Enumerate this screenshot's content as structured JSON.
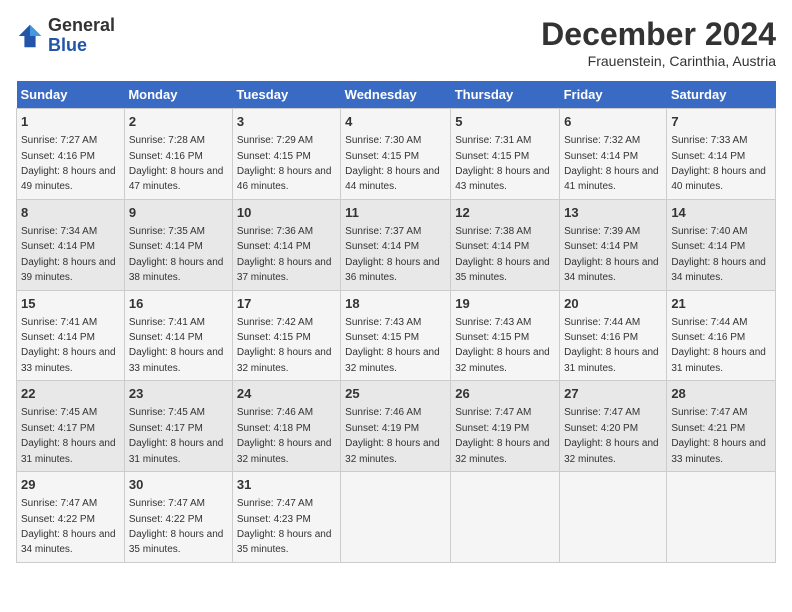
{
  "logo": {
    "general": "General",
    "blue": "Blue"
  },
  "header": {
    "month": "December 2024",
    "location": "Frauenstein, Carinthia, Austria"
  },
  "weekdays": [
    "Sunday",
    "Monday",
    "Tuesday",
    "Wednesday",
    "Thursday",
    "Friday",
    "Saturday"
  ],
  "weeks": [
    [
      {
        "day": "1",
        "sunrise": "Sunrise: 7:27 AM",
        "sunset": "Sunset: 4:16 PM",
        "daylight": "Daylight: 8 hours and 49 minutes."
      },
      {
        "day": "2",
        "sunrise": "Sunrise: 7:28 AM",
        "sunset": "Sunset: 4:16 PM",
        "daylight": "Daylight: 8 hours and 47 minutes."
      },
      {
        "day": "3",
        "sunrise": "Sunrise: 7:29 AM",
        "sunset": "Sunset: 4:15 PM",
        "daylight": "Daylight: 8 hours and 46 minutes."
      },
      {
        "day": "4",
        "sunrise": "Sunrise: 7:30 AM",
        "sunset": "Sunset: 4:15 PM",
        "daylight": "Daylight: 8 hours and 44 minutes."
      },
      {
        "day": "5",
        "sunrise": "Sunrise: 7:31 AM",
        "sunset": "Sunset: 4:15 PM",
        "daylight": "Daylight: 8 hours and 43 minutes."
      },
      {
        "day": "6",
        "sunrise": "Sunrise: 7:32 AM",
        "sunset": "Sunset: 4:14 PM",
        "daylight": "Daylight: 8 hours and 41 minutes."
      },
      {
        "day": "7",
        "sunrise": "Sunrise: 7:33 AM",
        "sunset": "Sunset: 4:14 PM",
        "daylight": "Daylight: 8 hours and 40 minutes."
      }
    ],
    [
      {
        "day": "8",
        "sunrise": "Sunrise: 7:34 AM",
        "sunset": "Sunset: 4:14 PM",
        "daylight": "Daylight: 8 hours and 39 minutes."
      },
      {
        "day": "9",
        "sunrise": "Sunrise: 7:35 AM",
        "sunset": "Sunset: 4:14 PM",
        "daylight": "Daylight: 8 hours and 38 minutes."
      },
      {
        "day": "10",
        "sunrise": "Sunrise: 7:36 AM",
        "sunset": "Sunset: 4:14 PM",
        "daylight": "Daylight: 8 hours and 37 minutes."
      },
      {
        "day": "11",
        "sunrise": "Sunrise: 7:37 AM",
        "sunset": "Sunset: 4:14 PM",
        "daylight": "Daylight: 8 hours and 36 minutes."
      },
      {
        "day": "12",
        "sunrise": "Sunrise: 7:38 AM",
        "sunset": "Sunset: 4:14 PM",
        "daylight": "Daylight: 8 hours and 35 minutes."
      },
      {
        "day": "13",
        "sunrise": "Sunrise: 7:39 AM",
        "sunset": "Sunset: 4:14 PM",
        "daylight": "Daylight: 8 hours and 34 minutes."
      },
      {
        "day": "14",
        "sunrise": "Sunrise: 7:40 AM",
        "sunset": "Sunset: 4:14 PM",
        "daylight": "Daylight: 8 hours and 34 minutes."
      }
    ],
    [
      {
        "day": "15",
        "sunrise": "Sunrise: 7:41 AM",
        "sunset": "Sunset: 4:14 PM",
        "daylight": "Daylight: 8 hours and 33 minutes."
      },
      {
        "day": "16",
        "sunrise": "Sunrise: 7:41 AM",
        "sunset": "Sunset: 4:14 PM",
        "daylight": "Daylight: 8 hours and 33 minutes."
      },
      {
        "day": "17",
        "sunrise": "Sunrise: 7:42 AM",
        "sunset": "Sunset: 4:15 PM",
        "daylight": "Daylight: 8 hours and 32 minutes."
      },
      {
        "day": "18",
        "sunrise": "Sunrise: 7:43 AM",
        "sunset": "Sunset: 4:15 PM",
        "daylight": "Daylight: 8 hours and 32 minutes."
      },
      {
        "day": "19",
        "sunrise": "Sunrise: 7:43 AM",
        "sunset": "Sunset: 4:15 PM",
        "daylight": "Daylight: 8 hours and 32 minutes."
      },
      {
        "day": "20",
        "sunrise": "Sunrise: 7:44 AM",
        "sunset": "Sunset: 4:16 PM",
        "daylight": "Daylight: 8 hours and 31 minutes."
      },
      {
        "day": "21",
        "sunrise": "Sunrise: 7:44 AM",
        "sunset": "Sunset: 4:16 PM",
        "daylight": "Daylight: 8 hours and 31 minutes."
      }
    ],
    [
      {
        "day": "22",
        "sunrise": "Sunrise: 7:45 AM",
        "sunset": "Sunset: 4:17 PM",
        "daylight": "Daylight: 8 hours and 31 minutes."
      },
      {
        "day": "23",
        "sunrise": "Sunrise: 7:45 AM",
        "sunset": "Sunset: 4:17 PM",
        "daylight": "Daylight: 8 hours and 31 minutes."
      },
      {
        "day": "24",
        "sunrise": "Sunrise: 7:46 AM",
        "sunset": "Sunset: 4:18 PM",
        "daylight": "Daylight: 8 hours and 32 minutes."
      },
      {
        "day": "25",
        "sunrise": "Sunrise: 7:46 AM",
        "sunset": "Sunset: 4:19 PM",
        "daylight": "Daylight: 8 hours and 32 minutes."
      },
      {
        "day": "26",
        "sunrise": "Sunrise: 7:47 AM",
        "sunset": "Sunset: 4:19 PM",
        "daylight": "Daylight: 8 hours and 32 minutes."
      },
      {
        "day": "27",
        "sunrise": "Sunrise: 7:47 AM",
        "sunset": "Sunset: 4:20 PM",
        "daylight": "Daylight: 8 hours and 32 minutes."
      },
      {
        "day": "28",
        "sunrise": "Sunrise: 7:47 AM",
        "sunset": "Sunset: 4:21 PM",
        "daylight": "Daylight: 8 hours and 33 minutes."
      }
    ],
    [
      {
        "day": "29",
        "sunrise": "Sunrise: 7:47 AM",
        "sunset": "Sunset: 4:22 PM",
        "daylight": "Daylight: 8 hours and 34 minutes."
      },
      {
        "day": "30",
        "sunrise": "Sunrise: 7:47 AM",
        "sunset": "Sunset: 4:22 PM",
        "daylight": "Daylight: 8 hours and 35 minutes."
      },
      {
        "day": "31",
        "sunrise": "Sunrise: 7:47 AM",
        "sunset": "Sunset: 4:23 PM",
        "daylight": "Daylight: 8 hours and 35 minutes."
      },
      null,
      null,
      null,
      null
    ]
  ]
}
